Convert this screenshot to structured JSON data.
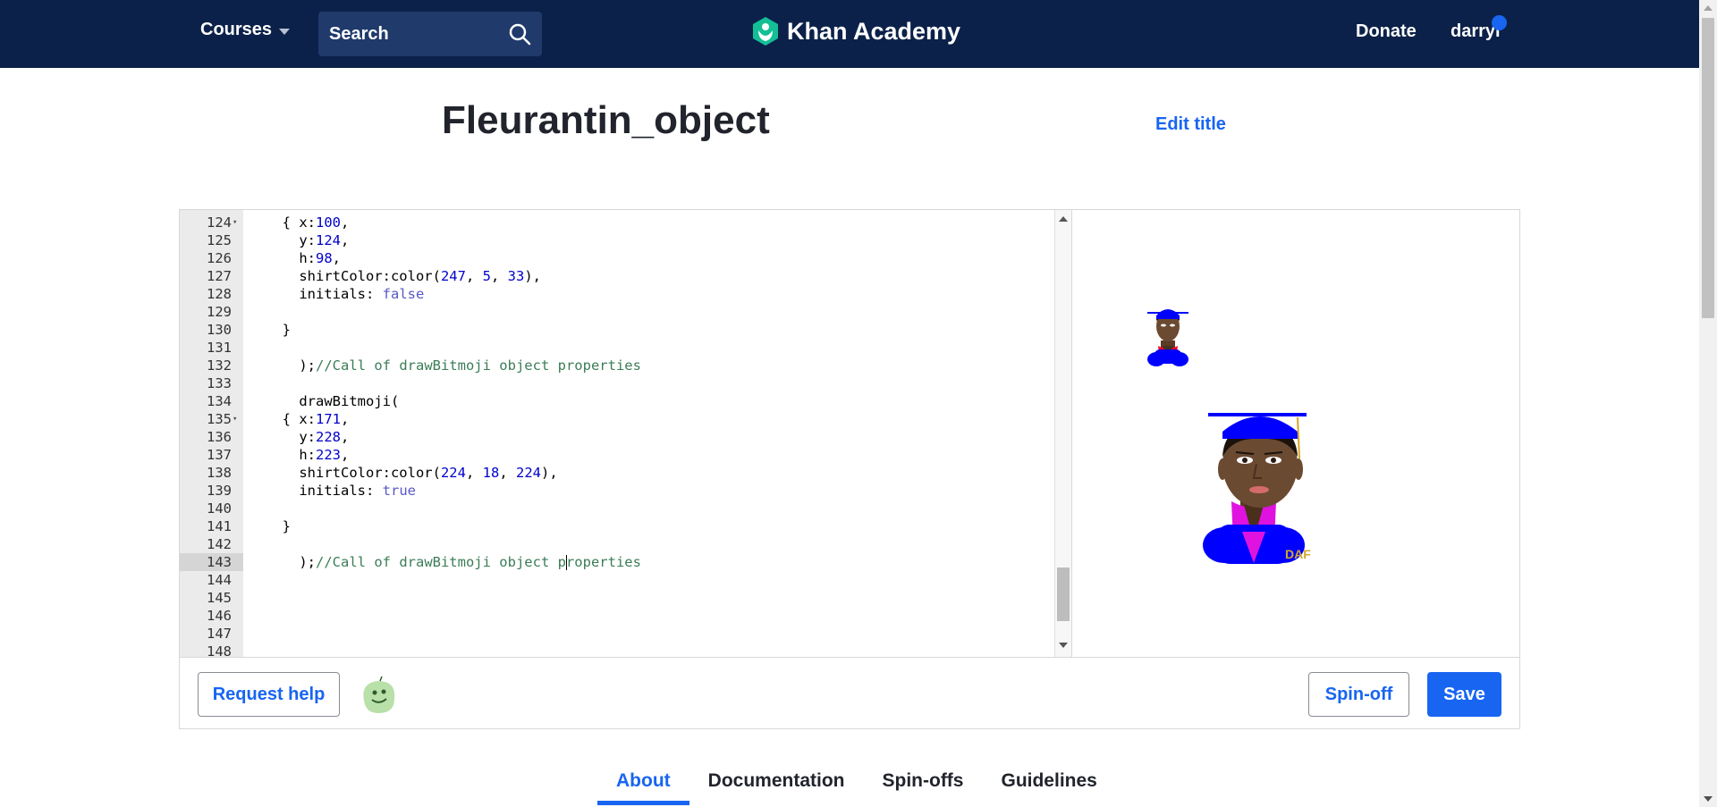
{
  "nav": {
    "courses_label": "Courses",
    "search_label": "Search",
    "brand": "Khan Academy",
    "donate_label": "Donate",
    "username": "darryl"
  },
  "page": {
    "title": "Fleurantin_object",
    "edit_title_label": "Edit title"
  },
  "editor": {
    "active_line": 143,
    "lines": [
      {
        "num": "124",
        "fold": true,
        "tokens": [
          {
            "t": "  { x:"
          },
          {
            "t": "100",
            "c": "n"
          },
          {
            "t": ","
          }
        ]
      },
      {
        "num": "125",
        "tokens": [
          {
            "t": "    y:"
          },
          {
            "t": "124",
            "c": "n"
          },
          {
            "t": ","
          }
        ]
      },
      {
        "num": "126",
        "tokens": [
          {
            "t": "    h:"
          },
          {
            "t": "98",
            "c": "n"
          },
          {
            "t": ","
          }
        ]
      },
      {
        "num": "127",
        "tokens": [
          {
            "t": "    shirtColor:color("
          },
          {
            "t": "247",
            "c": "n"
          },
          {
            "t": ", "
          },
          {
            "t": "5",
            "c": "n"
          },
          {
            "t": ", "
          },
          {
            "t": "33",
            "c": "n"
          },
          {
            "t": "),"
          }
        ]
      },
      {
        "num": "128",
        "tokens": [
          {
            "t": "    initials: "
          },
          {
            "t": "false",
            "c": "kw"
          }
        ]
      },
      {
        "num": "129",
        "tokens": []
      },
      {
        "num": "130",
        "tokens": [
          {
            "t": "  }"
          }
        ]
      },
      {
        "num": "131",
        "tokens": []
      },
      {
        "num": "132",
        "tokens": [
          {
            "t": "    );"
          },
          {
            "t": "//Call of drawBitmoji object properties",
            "c": "cm"
          }
        ]
      },
      {
        "num": "133",
        "tokens": []
      },
      {
        "num": "134",
        "tokens": [
          {
            "t": "    drawBitmoji("
          }
        ]
      },
      {
        "num": "135",
        "fold": true,
        "tokens": [
          {
            "t": "  { x:"
          },
          {
            "t": "171",
            "c": "n"
          },
          {
            "t": ","
          }
        ]
      },
      {
        "num": "136",
        "tokens": [
          {
            "t": "    y:"
          },
          {
            "t": "228",
            "c": "n"
          },
          {
            "t": ","
          }
        ]
      },
      {
        "num": "137",
        "tokens": [
          {
            "t": "    h:"
          },
          {
            "t": "223",
            "c": "n"
          },
          {
            "t": ","
          }
        ]
      },
      {
        "num": "138",
        "tokens": [
          {
            "t": "    shirtColor:color("
          },
          {
            "t": "224",
            "c": "n"
          },
          {
            "t": ", "
          },
          {
            "t": "18",
            "c": "n"
          },
          {
            "t": ", "
          },
          {
            "t": "224",
            "c": "n"
          },
          {
            "t": "),"
          }
        ]
      },
      {
        "num": "139",
        "tokens": [
          {
            "t": "    initials: "
          },
          {
            "t": "true",
            "c": "kw"
          }
        ]
      },
      {
        "num": "140",
        "tokens": []
      },
      {
        "num": "141",
        "tokens": [
          {
            "t": "  }"
          }
        ]
      },
      {
        "num": "142",
        "tokens": []
      },
      {
        "num": "143",
        "tokens": [
          {
            "t": "    );"
          },
          {
            "t": "//Call of drawBitmoji object p",
            "c": "cm"
          },
          {
            "t": "|",
            "c": "cursor"
          },
          {
            "t": "roperties",
            "c": "cm"
          }
        ]
      },
      {
        "num": "144",
        "tokens": []
      },
      {
        "num": "145",
        "tokens": []
      },
      {
        "num": "146",
        "tokens": []
      },
      {
        "num": "147",
        "tokens": []
      },
      {
        "num": "148",
        "tokens": []
      }
    ]
  },
  "canvas": {
    "initials_text": "DAF",
    "colors": {
      "hat": "#0000ff",
      "skin": "#6b4a32",
      "shirt_small": "#f70521",
      "shirt_large": "#e012e0",
      "tassel": "#d4a62a"
    }
  },
  "actions": {
    "request_help_label": "Request help",
    "spinoff_label": "Spin-off",
    "save_label": "Save"
  },
  "tabs": [
    {
      "label": "About",
      "active": true
    },
    {
      "label": "Documentation",
      "active": false
    },
    {
      "label": "Spin-offs",
      "active": false
    },
    {
      "label": "Guidelines",
      "active": false
    }
  ],
  "theme": {
    "nav_bg": "#0b2149",
    "accent": "#1865f2",
    "brand_green": "#14bf96"
  }
}
